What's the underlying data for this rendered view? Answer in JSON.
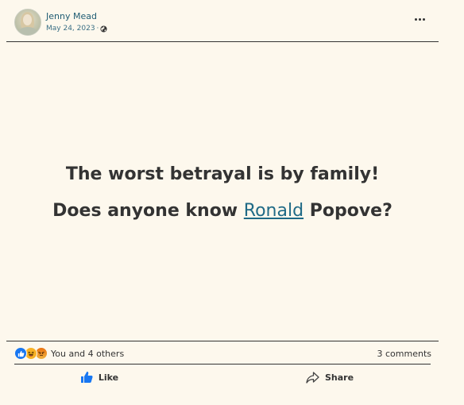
{
  "post": {
    "author": "Jenny Mead",
    "date": "May 24, 2023",
    "meta_separator": "·",
    "privacy_icon": "globe-icon",
    "more_icon": "more-horizontal-icon",
    "body": {
      "line1": "The worst betrayal is by family!",
      "line2_before": "Does anyone know ",
      "line2_link": "Ronald",
      "line2_after": " Popove?"
    },
    "reactions": {
      "icons": [
        "like-icon",
        "haha-icon",
        "angry-icon"
      ],
      "summary": "You and 4 others",
      "comments": "3 comments"
    },
    "actions": {
      "like_label": "Like",
      "share_label": "Share"
    }
  },
  "colors": {
    "background": "#fdf8ed",
    "author_link": "#1f5c73",
    "mention_link": "#1f6a86",
    "like_blue": "#1877f2",
    "text": "#333333"
  }
}
